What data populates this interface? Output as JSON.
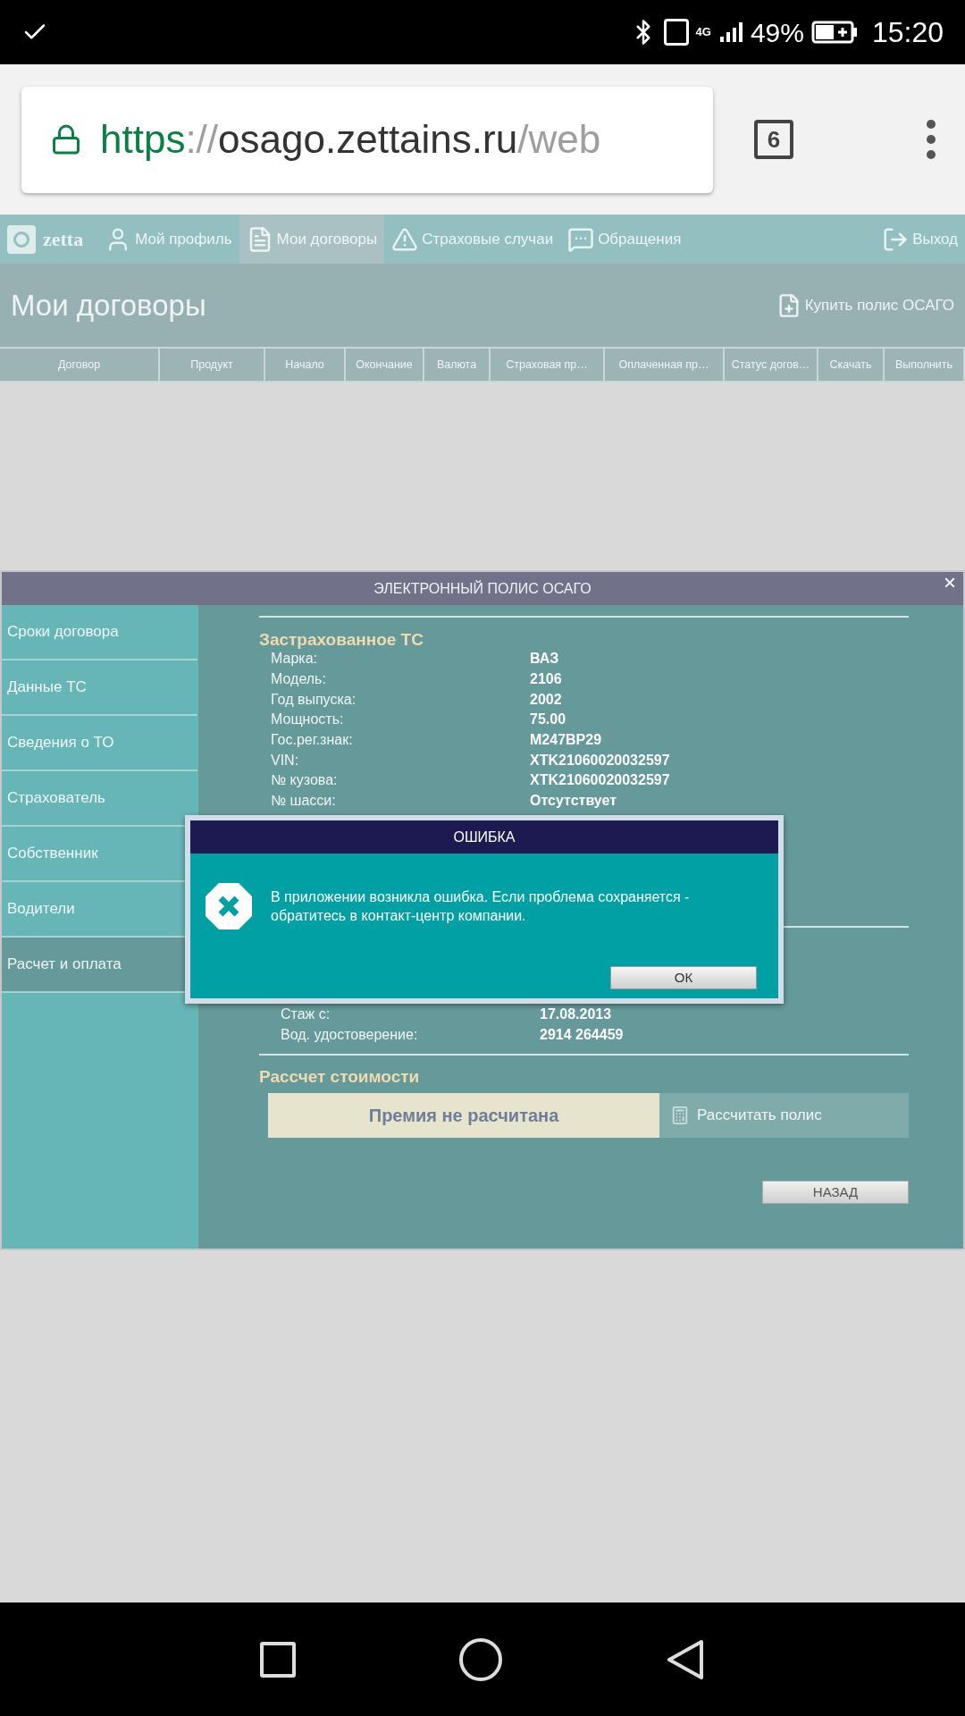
{
  "status_bar": {
    "network": "4G",
    "battery": "49%",
    "time": "15:20"
  },
  "browser": {
    "url": {
      "scheme": "https",
      "separator": "://",
      "host": "osago.zettains.ru",
      "path": "/web"
    },
    "tab_count": "6"
  },
  "nav": {
    "logo": "zetta",
    "items": [
      {
        "label": "Мой профиль",
        "kind": "profile",
        "selected": false
      },
      {
        "label": "Мои договоры",
        "kind": "contracts",
        "selected": true
      },
      {
        "label": "Страховые случаи",
        "kind": "claims",
        "selected": false
      },
      {
        "label": "Обращения",
        "kind": "messages",
        "selected": false
      },
      {
        "label": "Выход",
        "kind": "exit",
        "selected": false
      }
    ]
  },
  "page": {
    "title": "Мои договоры",
    "buy_link": "Купить полис ОСАГО",
    "table": {
      "columns": [
        "Договор",
        "Продукт",
        "Начало",
        "Окончание",
        "Валюта",
        "Страховая пр…",
        "Оплаченная пр…",
        "Статус догов…",
        "Скачать",
        "Выполнить"
      ]
    }
  },
  "modal": {
    "title": "ЭЛЕКТРОННЫЙ ПОЛИС ОСАГО",
    "close": "×",
    "menu": [
      {
        "label": "Сроки договора",
        "selected": false
      },
      {
        "label": "Данные ТС",
        "selected": false
      },
      {
        "label": "Сведения о ТО",
        "selected": false
      },
      {
        "label": "Страхователь",
        "selected": false
      },
      {
        "label": "Собственник",
        "selected": false
      },
      {
        "label": "Водители",
        "selected": false
      },
      {
        "label": "Расчет и оплата",
        "selected": true
      }
    ],
    "vehicle": {
      "heading": "Застрахованное ТС",
      "fields": [
        {
          "label": "Марка:",
          "value": "ВАЗ"
        },
        {
          "label": "Модель:",
          "value": "2106"
        },
        {
          "label": "Год выпуска:",
          "value": "2002"
        },
        {
          "label": "Мощность:",
          "value": "75.00"
        },
        {
          "label": "Гос.рег.знак:",
          "value": "М247ВР29"
        },
        {
          "label": "VIN:",
          "value": "XTK21060020032597"
        },
        {
          "label": "№ кузова:",
          "value": "XTK21060020032597"
        },
        {
          "label": "№ шасси:",
          "value": "Отсутствует"
        }
      ]
    },
    "driver_fields": [
      {
        "label": "Стаж с:",
        "value": "17.08.2013"
      },
      {
        "label": "Вод. удостоверение:",
        "value": "2914 264459"
      }
    ],
    "cost": {
      "heading": "Рассчет стоимости",
      "premium": "Премия не расчитана",
      "calculate": "Рассчитать полис"
    },
    "back": "НАЗАД"
  },
  "error_dialog": {
    "title": "ОШИБКА",
    "message": "В приложении возникла ошибка. Если проблема сохраняется - обратитесь в контакт-центр компании.",
    "ok": "ОК"
  }
}
